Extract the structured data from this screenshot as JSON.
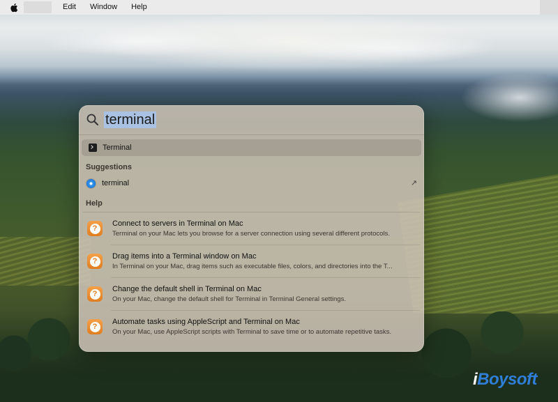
{
  "menubar": {
    "items": [
      "Edit",
      "Window",
      "Help"
    ],
    "apple_icon": "apple-logo"
  },
  "spotlight": {
    "query": "terminal",
    "top_hit": {
      "label": "Terminal",
      "icon": "terminal-icon"
    },
    "suggestions_title": "Suggestions",
    "suggestion": {
      "label": "terminal",
      "icon": "safari-icon",
      "action_icon": "arrow-up-right-icon"
    },
    "help_title": "Help",
    "help_items": [
      {
        "title": "Connect to servers in Terminal on Mac",
        "desc": "Terminal on your Mac lets you browse for a server connection using several different protocols."
      },
      {
        "title": "Drag items into a Terminal window on Mac",
        "desc": "In Terminal on your Mac, drag items such as executable files, colors, and directories into the T..."
      },
      {
        "title": "Change the default shell in Terminal on Mac",
        "desc": "On your Mac, change the default shell for Terminal in Terminal General settings."
      },
      {
        "title": "Automate tasks using AppleScript and Terminal on Mac",
        "desc": "On your Mac, use AppleScript scripts with Terminal to save time or to automate repetitive tasks."
      }
    ]
  },
  "watermark": {
    "prefix": "i",
    "brand": "Boysoft"
  },
  "colors": {
    "highlight": "#a9c2e3",
    "help_icon": "#e07d1f",
    "watermark": "#2f7ed8"
  }
}
